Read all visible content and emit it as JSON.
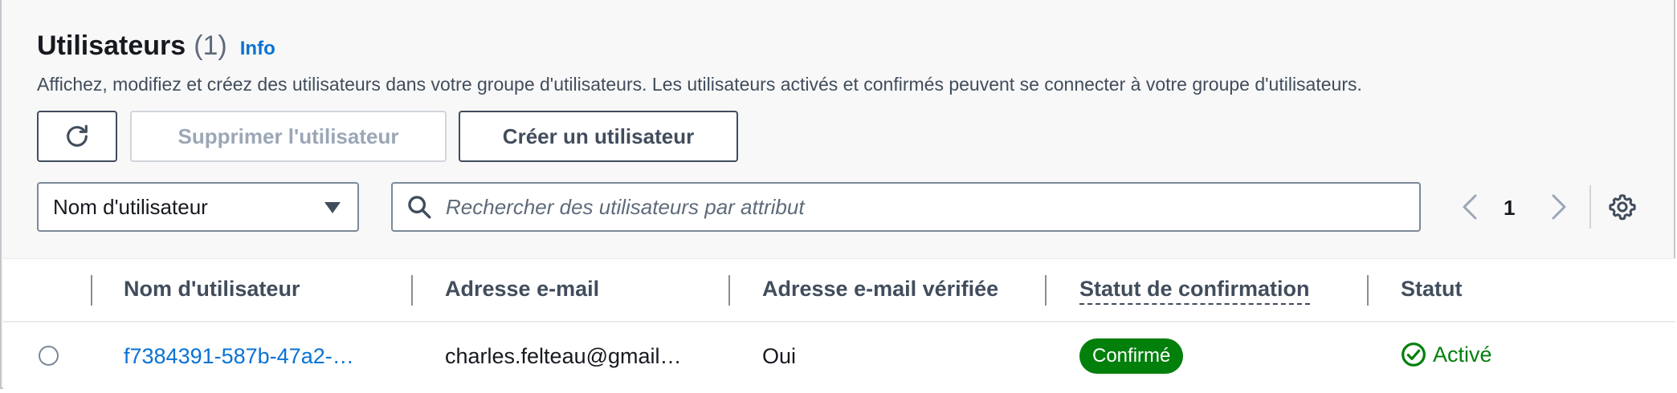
{
  "header": {
    "title": "Utilisateurs",
    "count": "(1)",
    "info_link": "Info",
    "description": "Affichez, modifiez et créez des utilisateurs dans votre groupe d'utilisateurs. Les utilisateurs activés et confirmés peuvent se connecter à votre groupe d'utilisateurs."
  },
  "actions": {
    "refresh_icon": "refresh-icon",
    "delete_label": "Supprimer l'utilisateur",
    "create_label": "Créer un utilisateur"
  },
  "filter": {
    "selected_attribute": "Nom d'utilisateur",
    "search_placeholder": "Rechercher des utilisateurs par attribut"
  },
  "pagination": {
    "current_page": "1"
  },
  "table": {
    "columns": [
      "Nom d'utilisateur",
      "Adresse e-mail",
      "Adresse e-mail vérifiée",
      "Statut de confirmation",
      "Statut"
    ],
    "rows": [
      {
        "username": "f7384391-587b-47a2-…",
        "email": "charles.felteau@gmail…",
        "email_verified": "Oui",
        "confirmation_status": "Confirmé",
        "status": "Activé"
      }
    ]
  },
  "colors": {
    "link": "#0972d3",
    "success": "#037f0c",
    "text": "#16191f",
    "muted": "#5f6b7a"
  }
}
